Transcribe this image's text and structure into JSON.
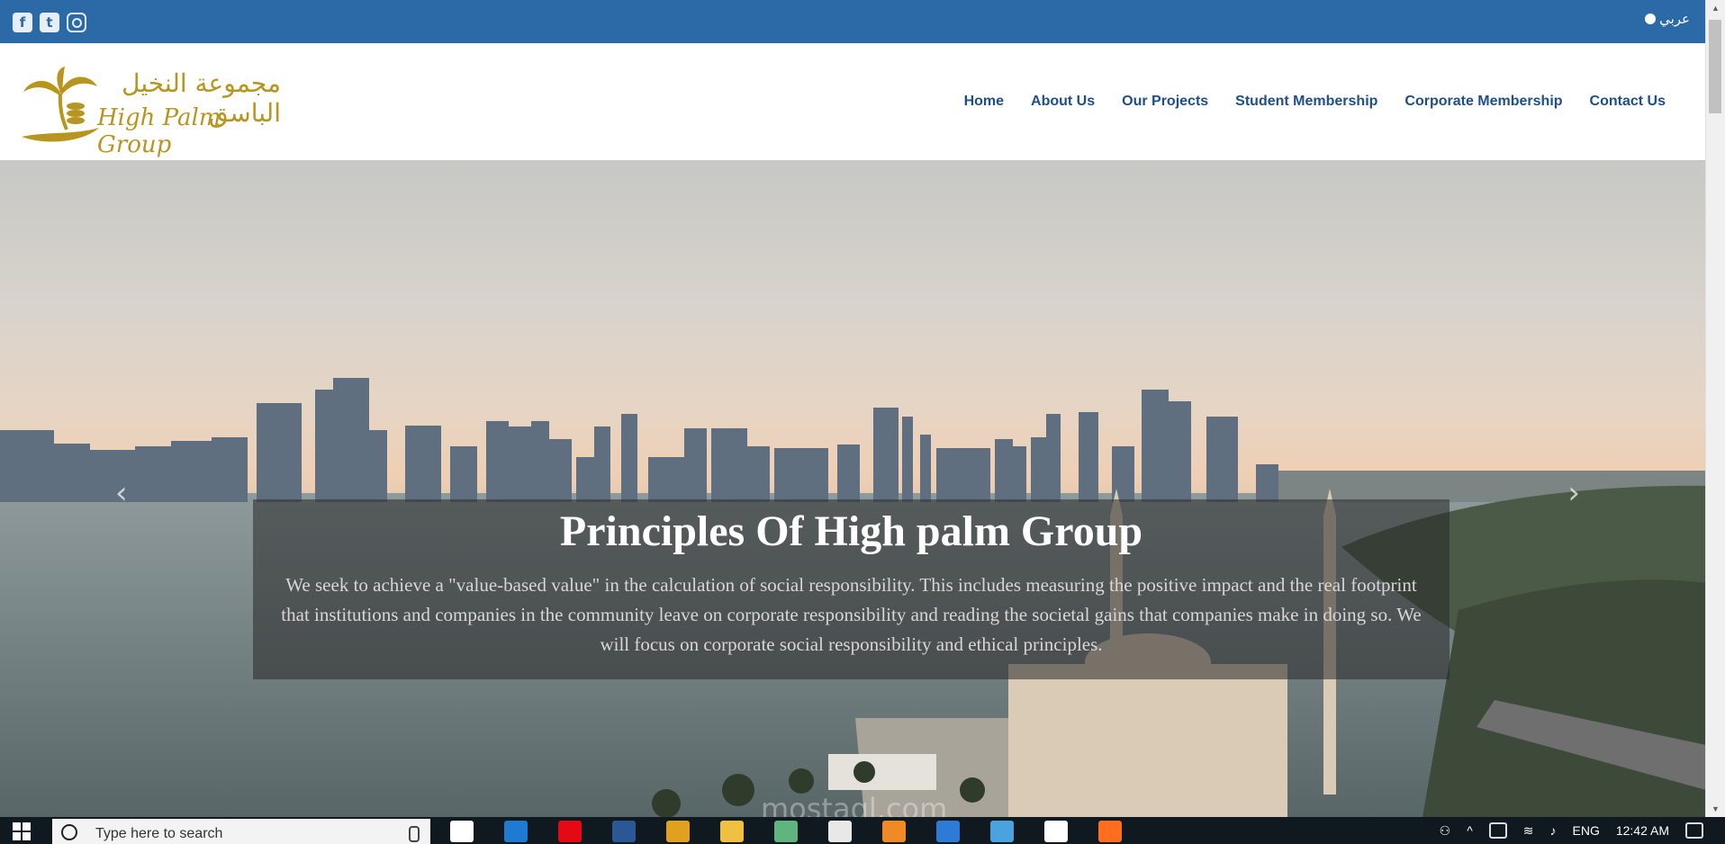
{
  "topbar": {
    "social": [
      {
        "name": "facebook-icon",
        "glyph": "f"
      },
      {
        "name": "twitter-icon",
        "glyph": "t"
      },
      {
        "name": "instagram-icon",
        "glyph": ""
      }
    ],
    "lang_label": "عربي",
    "color": "#2b6aa6"
  },
  "logo": {
    "arabic": "مجموعة النخيل الباسق",
    "english": "High Palm Group",
    "color": "#b8951f"
  },
  "nav": {
    "items": [
      "Home",
      "About Us",
      "Our Projects",
      "Student Membership",
      "Corporate Membership",
      "Contact Us"
    ],
    "color": "#1e4f8a"
  },
  "hero": {
    "title": "Principles Of High palm Group",
    "text": "We seek to achieve a \"value-based value\" in the calculation of social responsibility. This includes measuring the positive impact and the real footprint that institutions and companies in the community leave on corporate responsibility and reading the societal gains that companies make in doing so. We will focus on corporate social responsibility and ethical principles.",
    "prev": "‹",
    "next": "›"
  },
  "watermark": "mostaql.com",
  "taskbar": {
    "search_placeholder": "Type here to search",
    "apps": [
      {
        "name": "task-view-icon",
        "color": "#ffffff"
      },
      {
        "name": "edge-icon",
        "color": "#1f7bd1"
      },
      {
        "name": "netflix-icon",
        "color": "#e50914"
      },
      {
        "name": "word-icon",
        "color": "#2b5797"
      },
      {
        "name": "chrome-icon",
        "color": "#e0a020"
      },
      {
        "name": "file-explorer-icon",
        "color": "#f0c040"
      },
      {
        "name": "atom-icon",
        "color": "#5fb57d"
      },
      {
        "name": "store-icon",
        "color": "#e8e8e8"
      },
      {
        "name": "sublime-icon",
        "color": "#f08a24"
      },
      {
        "name": "pycharm-icon",
        "color": "#2d7bd6"
      },
      {
        "name": "app-icon",
        "color": "#4aa3df"
      },
      {
        "name": "mail-icon",
        "color": "#ffffff"
      },
      {
        "name": "firefox-icon",
        "color": "#ff6d1f"
      }
    ],
    "lang": "ENG",
    "time": "12:42 AM"
  }
}
